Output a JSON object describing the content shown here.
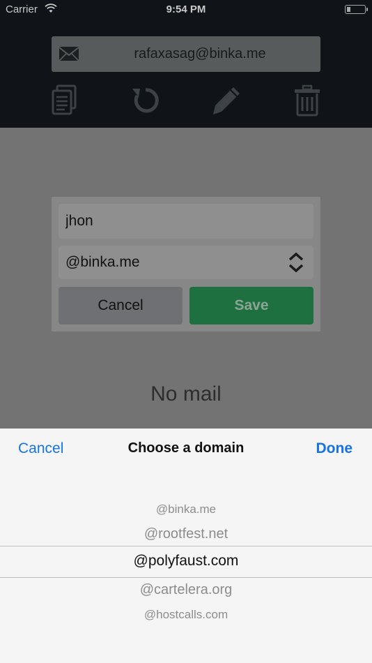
{
  "status_bar": {
    "carrier": "Carrier",
    "time": "9:54 PM"
  },
  "header": {
    "email": "rafaxasag@binka.me",
    "actions": [
      {
        "name": "copy",
        "icon": "copy-icon"
      },
      {
        "name": "refresh",
        "icon": "refresh-icon"
      },
      {
        "name": "edit",
        "icon": "pencil-icon"
      },
      {
        "name": "delete",
        "icon": "trash-icon"
      }
    ]
  },
  "dialog": {
    "name_value": "jhon",
    "domain_value": "@binka.me",
    "cancel_label": "Cancel",
    "save_label": "Save"
  },
  "main": {
    "empty_text": "No mail"
  },
  "picker": {
    "cancel_label": "Cancel",
    "title": "Choose a domain",
    "done_label": "Done",
    "options": [
      "@binka.me",
      "@rootfest.net",
      "@polyfaust.com",
      "@cartelera.org",
      "@hostcalls.com"
    ],
    "selected_index": 2
  },
  "colors": {
    "accent_blue": "#1572e8",
    "save_green": "#1e7040",
    "header_bg": "#101418"
  }
}
